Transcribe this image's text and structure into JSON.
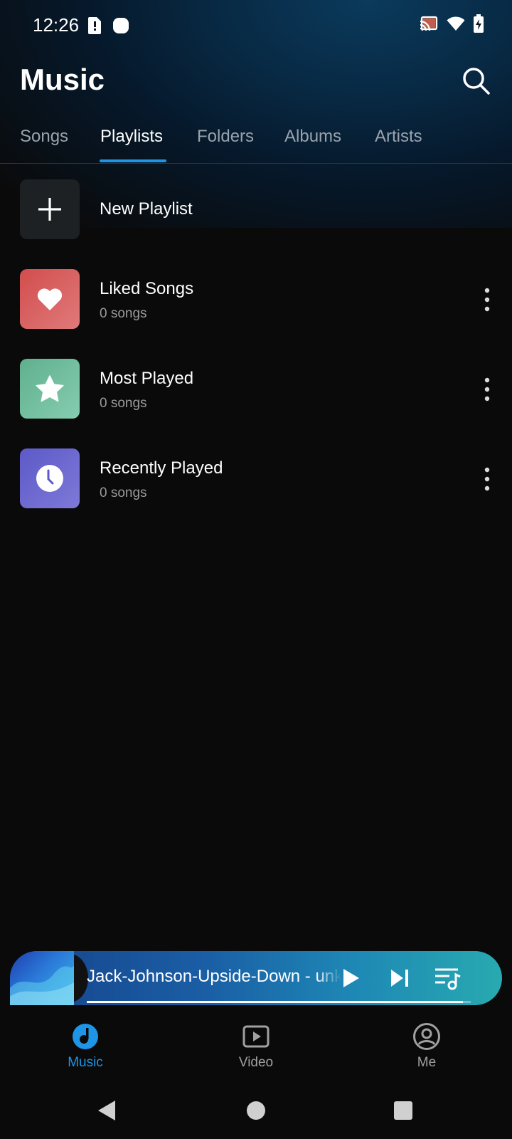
{
  "status_bar": {
    "time": "12:26",
    "icons": [
      "sim-alert-icon",
      "circle-notification-icon",
      "cast-icon",
      "wifi-icon",
      "battery-charging-icon"
    ]
  },
  "header": {
    "title": "Music",
    "search_icon": "search-icon"
  },
  "tabs": {
    "items": [
      {
        "label": "Songs"
      },
      {
        "label": "Playlists"
      },
      {
        "label": "Folders"
      },
      {
        "label": "Albums"
      },
      {
        "label": "Artists"
      }
    ],
    "active_index": 1
  },
  "playlists": {
    "new_playlist_label": "New Playlist",
    "items": [
      {
        "title": "Liked Songs",
        "count": "0 songs",
        "icon": "heart-icon",
        "color": "#d95a5a"
      },
      {
        "title": "Most Played",
        "count": "0 songs",
        "icon": "star-icon",
        "color": "#6dbb9a"
      },
      {
        "title": "Recently Played",
        "count": "0 songs",
        "icon": "clock-icon",
        "color": "#6b67cf"
      }
    ]
  },
  "mini_player": {
    "track_title": "Jack-Johnson-Upside-Down - unknown",
    "progress": 0.98
  },
  "bottom_nav": {
    "items": [
      {
        "label": "Music",
        "icon": "music-note-icon",
        "active": true
      },
      {
        "label": "Video",
        "icon": "video-play-icon",
        "active": false
      },
      {
        "label": "Me",
        "icon": "profile-icon",
        "active": false
      }
    ]
  },
  "colors": {
    "accent": "#1f95e8",
    "background": "#0a0a0a"
  }
}
